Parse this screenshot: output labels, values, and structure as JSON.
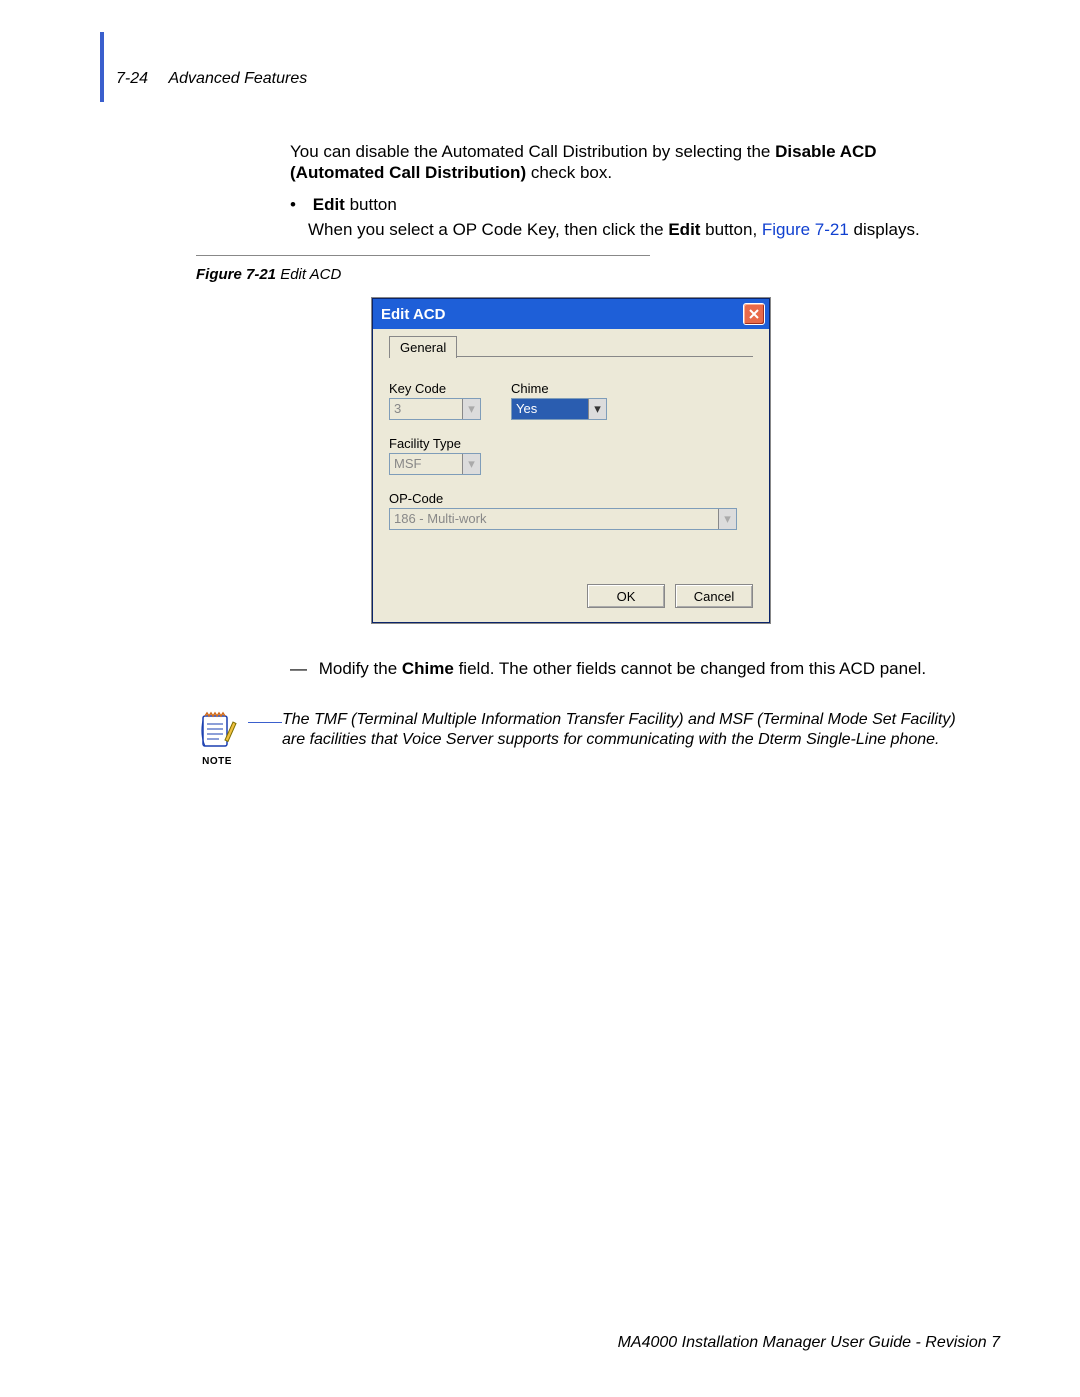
{
  "header": {
    "page_num": "7-24",
    "section": "Advanced Features"
  },
  "para1_a": "You can disable the Automated Call Distribution by selecting the ",
  "para1_b": "Disable ACD (Automated Call Distribution)",
  "para1_c": " check box.",
  "bullet": {
    "label": "Edit",
    "suffix": " button",
    "line_a": "When you select a OP Code Key, then click the ",
    "line_b": "Edit",
    "line_c": " button, ",
    "line_link": "Figure 7-21",
    "line_d": " displays."
  },
  "figcap": {
    "fig": "Figure 7-21",
    "title": "  Edit ACD"
  },
  "dialog": {
    "title": "Edit ACD",
    "tab": "General",
    "keycode_label": "Key Code",
    "keycode_value": "3",
    "chime_label": "Chime",
    "chime_value": "Yes",
    "facility_label": "Facility Type",
    "facility_value": "MSF",
    "opcode_label": "OP-Code",
    "opcode_value": "186 - Multi-work",
    "ok": "OK",
    "cancel": "Cancel"
  },
  "modify": {
    "dash": "—",
    "a": "Modify the ",
    "b": "Chime",
    "c": " field. The other fields cannot be changed from this ACD panel."
  },
  "note": {
    "label": "NOTE",
    "text": "The TMF (Terminal Multiple Information Transfer Facility) and MSF (Terminal Mode Set Facility) are facilities that Voice Server supports for communicating with the Dterm Single-Line phone."
  },
  "footer": "MA4000 Installation Manager User Guide - Revision 7"
}
